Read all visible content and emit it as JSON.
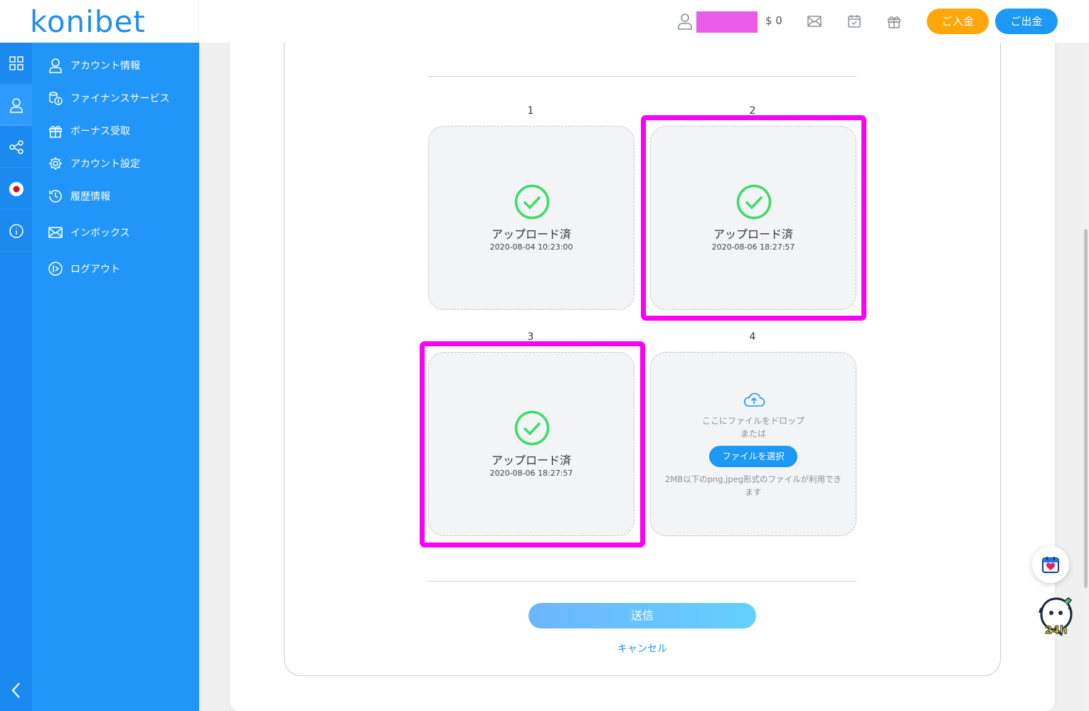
{
  "header": {
    "logo": "konibet",
    "balance": "$ 0",
    "deposit_label": "ご入金",
    "withdraw_label": "ご出金"
  },
  "sidebar": {
    "items": [
      {
        "label": "アカウント情報",
        "icon": "user-icon"
      },
      {
        "label": "ファイナンスサービス",
        "icon": "coins-icon"
      },
      {
        "label": "ボーナス受取",
        "icon": "gift-icon"
      },
      {
        "label": "アカウント設定",
        "icon": "gear-icon"
      },
      {
        "label": "履歴情報",
        "icon": "history-icon"
      },
      {
        "label": "インボックス",
        "icon": "mail-icon"
      },
      {
        "label": "ログアウト",
        "icon": "logout-icon"
      }
    ]
  },
  "uploads": {
    "slots": [
      {
        "number": "1",
        "status": "アップロード済",
        "time": "2020-08-04 10:23:00"
      },
      {
        "number": "2",
        "status": "アップロード済",
        "time": "2020-08-06 18:27:57"
      },
      {
        "number": "3",
        "status": "アップロード済",
        "time": "2020-08-06 18:27:57"
      },
      {
        "number": "4",
        "drop_line1": "ここにファイルをドロップ",
        "drop_line2": "または",
        "select_label": "ファイルを選択",
        "hint_line1": "2MB以下のpng,jpeg形式のファイルが利用でき",
        "hint_line2": "ます"
      }
    ]
  },
  "actions": {
    "submit_label": "送信",
    "cancel_label": "キャンセル"
  },
  "colors": {
    "brand": "#1f8fe8",
    "sidebar": "#2196f8",
    "deposit": "#ffa60a",
    "withdraw": "#1c98f5",
    "check": "#3ddc6a",
    "highlight": "#fb00f5"
  }
}
